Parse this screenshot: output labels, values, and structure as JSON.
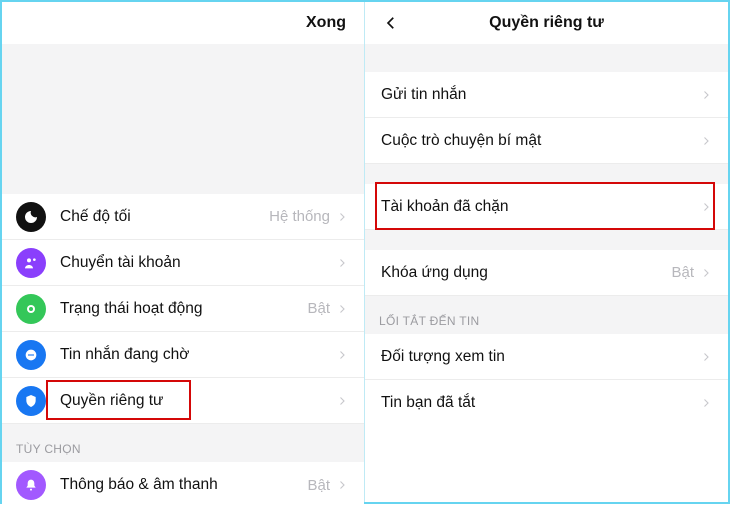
{
  "left": {
    "done": "Xong",
    "items": [
      {
        "label": "Chế độ tối",
        "value": "Hệ thống"
      },
      {
        "label": "Chuyển tài khoản",
        "value": ""
      },
      {
        "label": "Trạng thái hoạt động",
        "value": "Bật"
      },
      {
        "label": "Tin nhắn đang chờ",
        "value": ""
      },
      {
        "label": "Quyền riêng tư",
        "value": ""
      }
    ],
    "section_title": "TÙY CHỌN",
    "items2": [
      {
        "label": "Thông báo & âm thanh",
        "value": "Bật"
      }
    ]
  },
  "right": {
    "title": "Quyền riêng tư",
    "group1": [
      {
        "label": "Gửi tin nhắn"
      },
      {
        "label": "Cuộc trò chuyện bí mật"
      }
    ],
    "group2": [
      {
        "label": "Tài khoản đã chặn"
      }
    ],
    "group3": [
      {
        "label": "Khóa ứng dụng",
        "value": "Bật"
      }
    ],
    "section_title": "LỐI TẮT ĐẾN TIN",
    "group4": [
      {
        "label": "Đối tượng xem tin"
      },
      {
        "label": "Tin bạn đã tắt"
      }
    ]
  }
}
